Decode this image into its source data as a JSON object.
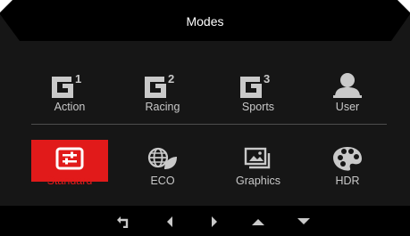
{
  "osd": {
    "title": "Modes",
    "row1": [
      {
        "label": "Action",
        "icon": "g1-icon",
        "sup": "1"
      },
      {
        "label": "Racing",
        "icon": "g2-icon",
        "sup": "2"
      },
      {
        "label": "Sports",
        "icon": "g3-icon",
        "sup": "3"
      },
      {
        "label": "User",
        "icon": "user-icon"
      }
    ],
    "row2": [
      {
        "label": "Standard",
        "icon": "sliders-icon",
        "selected": true
      },
      {
        "label": "ECO",
        "icon": "eco-globe-icon"
      },
      {
        "label": "Graphics",
        "icon": "pictures-icon"
      },
      {
        "label": "HDR",
        "icon": "palette-icon"
      }
    ],
    "nav": [
      "back-icon",
      "left-arrow-icon",
      "right-arrow-icon",
      "up-arrow-icon",
      "down-arrow-icon"
    ],
    "colors": {
      "background": "#161616",
      "header": "#000000",
      "accent": "#e11a1a",
      "text": "#c9c9c9",
      "title": "#ffffff"
    }
  }
}
